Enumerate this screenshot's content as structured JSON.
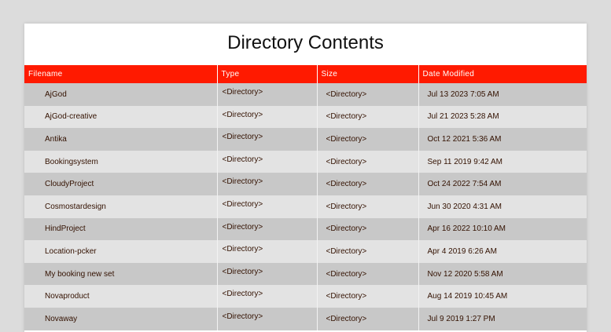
{
  "page": {
    "title": "Directory Contents"
  },
  "table": {
    "headers": [
      "Filename",
      "Type",
      "Size",
      "Date Modified"
    ],
    "rows": [
      {
        "filename": "AjGod",
        "type": "<Directory>",
        "size": "<Directory>",
        "date": "Jul 13 2023 7:05 AM"
      },
      {
        "filename": "AjGod-creative",
        "type": "<Directory>",
        "size": "<Directory>",
        "date": "Jul 21 2023 5:28 AM"
      },
      {
        "filename": "Antika",
        "type": "<Directory>",
        "size": "<Directory>",
        "date": "Oct 12 2021 5:36 AM"
      },
      {
        "filename": "Bookingsystem",
        "type": "<Directory>",
        "size": "<Directory>",
        "date": "Sep 11 2019 9:42 AM"
      },
      {
        "filename": "CloudyProject",
        "type": "<Directory>",
        "size": "<Directory>",
        "date": "Oct 24 2022 7:54 AM"
      },
      {
        "filename": "Cosmostardesign",
        "type": "<Directory>",
        "size": "<Directory>",
        "date": "Jun 30 2020 4:31 AM"
      },
      {
        "filename": "HindProject",
        "type": "<Directory>",
        "size": "<Directory>",
        "date": "Apr 16 2022 10:10 AM"
      },
      {
        "filename": "Location-pcker",
        "type": "<Directory>",
        "size": "<Directory>",
        "date": "Apr 4 2019 6:26 AM"
      },
      {
        "filename": "My booking new set",
        "type": "<Directory>",
        "size": "<Directory>",
        "date": "Nov 12 2020 5:58 AM"
      },
      {
        "filename": "Novaproduct",
        "type": "<Directory>",
        "size": "<Directory>",
        "date": "Aug 14 2019 10:45 AM"
      },
      {
        "filename": "Novaway",
        "type": "<Directory>",
        "size": "<Directory>",
        "date": "Jul 9 2019 1:27 PM"
      }
    ]
  },
  "colors": {
    "header_bg": "#ff1a00",
    "row_odd": "#c8c8c8",
    "row_even": "#e3e3e3",
    "text": "#331100"
  }
}
